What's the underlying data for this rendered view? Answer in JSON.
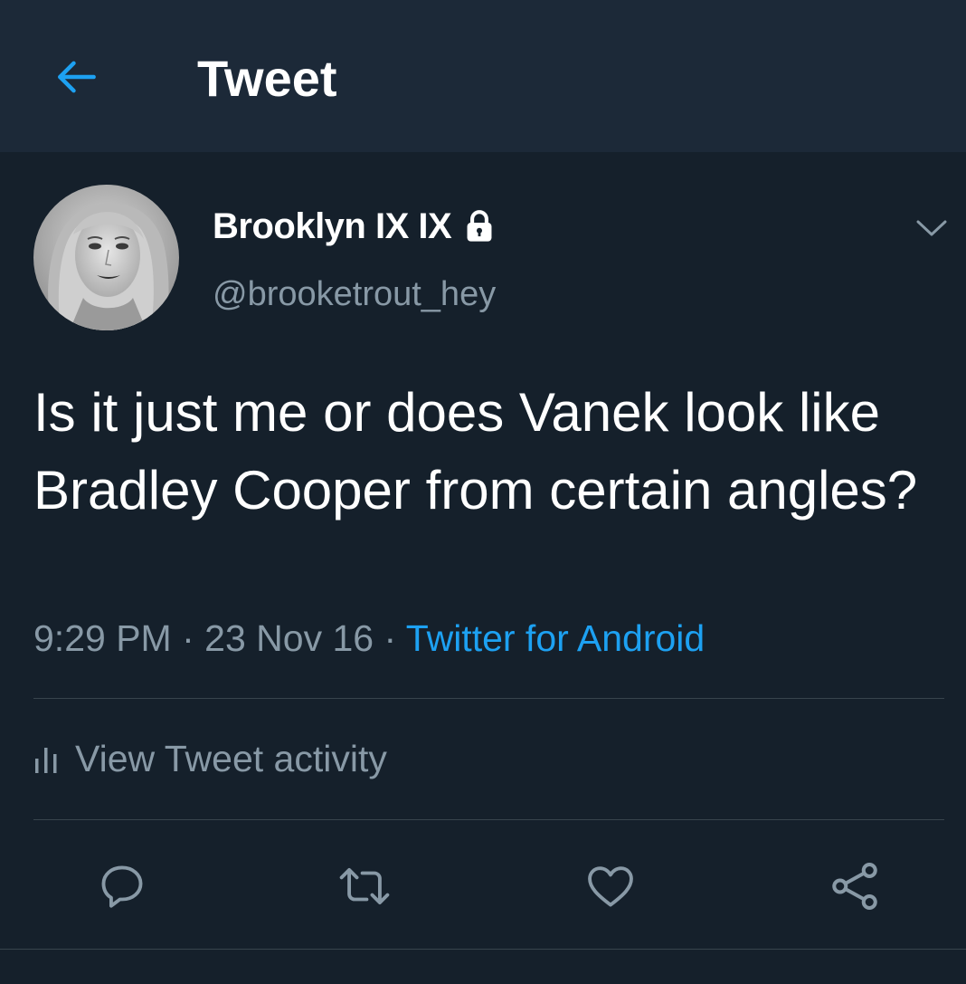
{
  "colors": {
    "background": "#15202b",
    "header": "#1c2938",
    "accent": "#1da1f2",
    "secondary_text": "#8899a6",
    "divider": "#38444d"
  },
  "header": {
    "back_icon": "arrow-left-icon",
    "title": "Tweet"
  },
  "tweet": {
    "display_name": "Brooklyn IX IX",
    "protected_icon": "lock-icon",
    "handle": "@brooketrout_hey",
    "more_icon": "chevron-down-icon",
    "text": "Is it just me or does Vanek look like Bradley Cooper from certain angles?",
    "time": "9:29 PM",
    "separator": "·",
    "date": "23 Nov 16",
    "source": "Twitter for Android"
  },
  "activity": {
    "icon": "bar-chart-icon",
    "label": "View Tweet activity"
  },
  "actions": [
    {
      "icon": "reply-icon"
    },
    {
      "icon": "retweet-icon"
    },
    {
      "icon": "like-icon"
    },
    {
      "icon": "share-icon"
    }
  ]
}
